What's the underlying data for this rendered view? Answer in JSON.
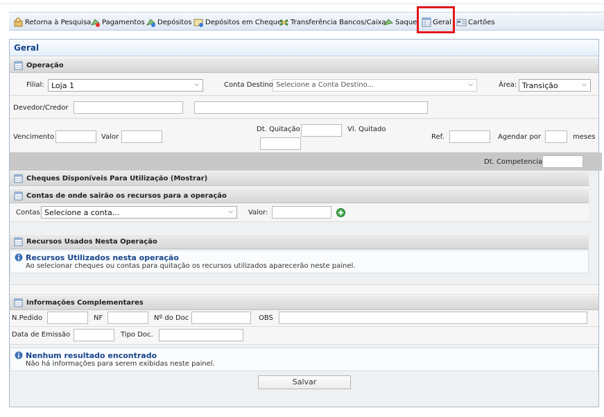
{
  "toolbar": {
    "items": [
      {
        "label": "Retorna à Pesquisa",
        "icon": "search-return-icon"
      },
      {
        "label": "Pagamentos",
        "icon": "payments-icon"
      },
      {
        "label": "Depósitos",
        "icon": "deposits-icon"
      },
      {
        "label": "Depósitos em Cheque",
        "icon": "check-deposit-icon"
      },
      {
        "label": "Transferência Bancos/Caixas",
        "icon": "transfer-icon"
      },
      {
        "label": "Saque",
        "icon": "withdraw-icon"
      },
      {
        "label": "Geral",
        "icon": "grid-icon"
      },
      {
        "label": "Cartões",
        "icon": "card-icon"
      }
    ]
  },
  "panel": {
    "title": "Geral"
  },
  "operacao": {
    "title": "Operação",
    "filial_label": "Filial:",
    "filial_value": "Loja 1",
    "conta_destino_label": "Conta Destino",
    "conta_destino_value": "Selecione a Conta Destino...",
    "area_label": "Área:",
    "area_value": "Transição",
    "devedor_label": "Devedor/Credor",
    "vencimento_label": "Vencimento",
    "valor_label": "Valor",
    "dt_quitacao_label": "Dt. Quitação",
    "vl_quitado_label": "Vl. Quitado",
    "ref_label": "Ref.",
    "agendar_label": "Agendar por",
    "meses_label": "meses",
    "dt_competencia_label": "Dt. Competencia"
  },
  "cheques": {
    "title": "Cheques Disponíveis Para Utilização (Mostrar)"
  },
  "contas": {
    "title": "Contas de onde sairão os recursos para a operação",
    "contas_label": "Contas:",
    "contas_value": "Selecione a conta...",
    "valor_label": "Valor:"
  },
  "recursos": {
    "title": "Recursos Usados Nesta Operação",
    "info_title": "Recursos Utilizados nesta operação",
    "info_text": "Ao selecionar cheques ou contas para quitação os recursos utilizados aparecerão neste painel."
  },
  "info_compl": {
    "title": "Informações Complementares",
    "npedido_label": "N.Pedido",
    "nf_label": "NF",
    "ndoc_label": "Nº do Doc",
    "obs_label": "OBS",
    "data_emissao_label": "Data de Emissão",
    "tipo_doc_label": "Tipo Doc."
  },
  "resultado": {
    "title": "Nenhum resultado encontrado",
    "text": "Não há informações para serem exibidas neste painel."
  },
  "actions": {
    "save_label": "Salvar"
  },
  "colors": {
    "highlight": "#e3161b",
    "title_blue": "#16458a",
    "add_green": "#3aa84a"
  }
}
